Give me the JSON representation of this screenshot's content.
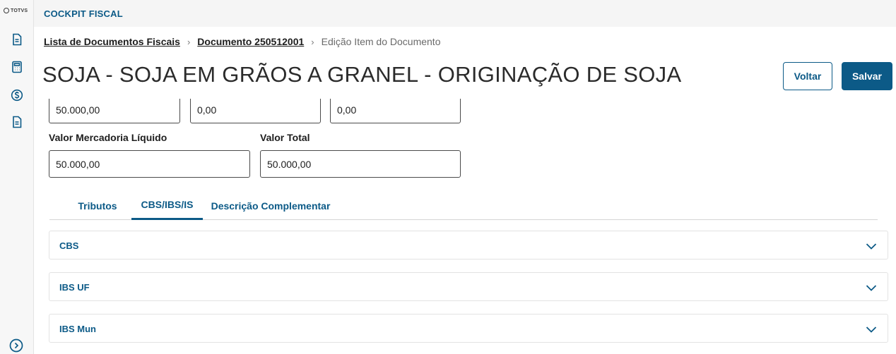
{
  "sidebar": {
    "logo_text": "TOTVS",
    "icons": [
      "document-icon",
      "calculator-icon",
      "dollar-icon",
      "document-list-icon"
    ],
    "expand_icon": "chevron-right-circle-icon"
  },
  "header": {
    "app_title": "COCKPIT FISCAL"
  },
  "breadcrumb": {
    "items": [
      "Lista de Documentos Fiscais",
      "Documento 250512001",
      "Edição Item do Documento"
    ],
    "separator": "›"
  },
  "page": {
    "title": "SOJA - SOJA EM GRÃOS A GRANEL - ORIGINAÇÃO DE SOJA",
    "back_label": "Voltar",
    "save_label": "Salvar"
  },
  "fields": {
    "row1": [
      "50.000,00",
      "0,00",
      "0,00"
    ],
    "valor_mercadoria_liquido": {
      "label": "Valor Mercadoria Líquido",
      "value": "50.000,00"
    },
    "valor_total": {
      "label": "Valor Total",
      "value": "50.000,00"
    }
  },
  "tabs": [
    {
      "label": "Tributos",
      "active": false
    },
    {
      "label": "CBS/IBS/IS",
      "active": true
    },
    {
      "label": "Descrição Complementar",
      "active": false
    }
  ],
  "accordions": [
    "CBS",
    "IBS UF",
    "IBS Mun"
  ],
  "colors": {
    "brand": "#0c5a87",
    "border": "#4a4a4a"
  }
}
